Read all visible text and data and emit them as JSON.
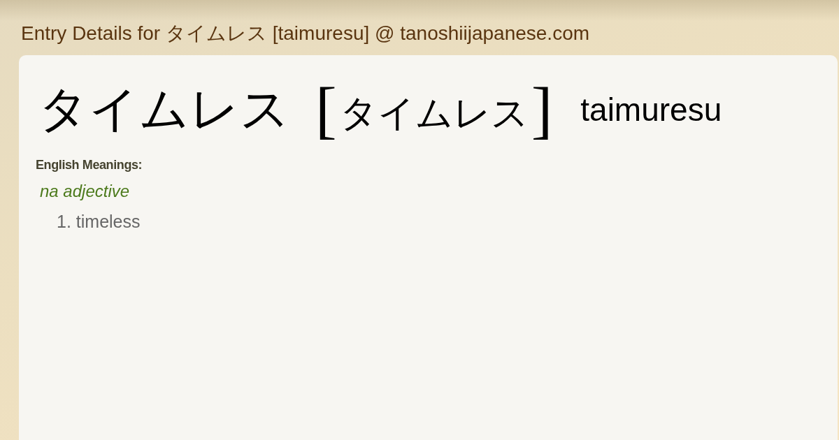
{
  "page": {
    "title": "Entry Details for タイムレス [taimuresu] @ tanoshiijapanese.com"
  },
  "entry": {
    "word": "タイムレス",
    "reading": {
      "open": "[",
      "kana": "タイムレス",
      "close": "]"
    },
    "romaji": "taimuresu",
    "meanings": {
      "label": "English Meanings:",
      "groups": [
        {
          "part_of_speech": "na adjective",
          "senses": [
            {
              "number": "1.",
              "gloss": "timeless"
            }
          ]
        }
      ]
    }
  }
}
